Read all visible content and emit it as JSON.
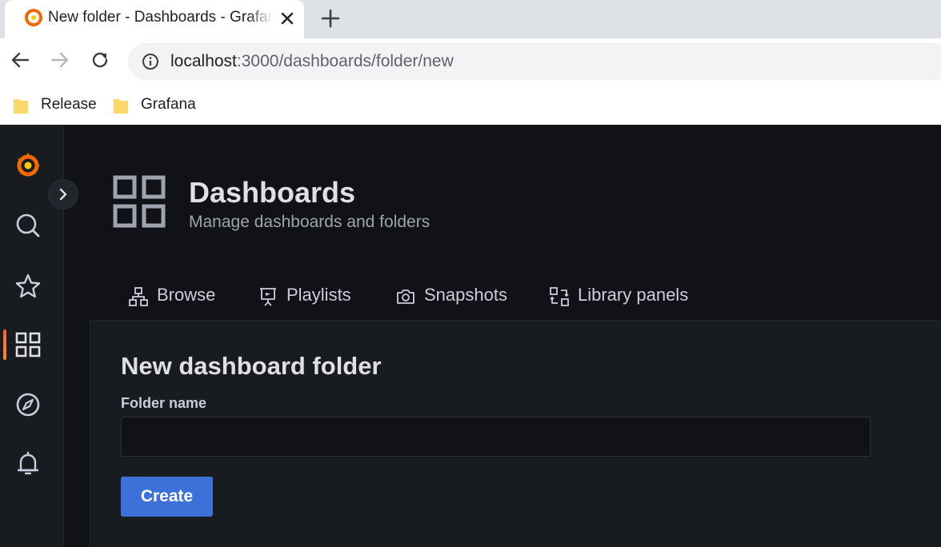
{
  "browser": {
    "tab": {
      "title": "New folder - Dashboards - Grafana"
    },
    "address": {
      "host": "localhost",
      "path": ":3000/dashboards/folder/new"
    },
    "bookmarks": [
      {
        "label": "Release"
      },
      {
        "label": "Grafana"
      }
    ]
  },
  "header": {
    "title": "Dashboards",
    "subtitle": "Manage dashboards and folders"
  },
  "tabs": [
    {
      "label": "Browse",
      "icon": "sitemap-icon"
    },
    {
      "label": "Playlists",
      "icon": "presentation-icon"
    },
    {
      "label": "Snapshots",
      "icon": "camera-icon"
    },
    {
      "label": "Library panels",
      "icon": "library-panel-icon"
    }
  ],
  "sidemenu": {
    "items": [
      "grafana-logo-icon",
      "search-icon",
      "star-icon",
      "apps-icon",
      "compass-icon",
      "bell-icon"
    ],
    "active": "apps-icon"
  },
  "form": {
    "title": "New dashboard folder",
    "folder_name_label": "Folder name",
    "folder_name_value": "",
    "create_label": "Create"
  },
  "colors": {
    "app_bg": "#111217",
    "panel_bg": "#181b1f",
    "primary_button": "#3d71d9",
    "active_accent": "#ff8833"
  }
}
